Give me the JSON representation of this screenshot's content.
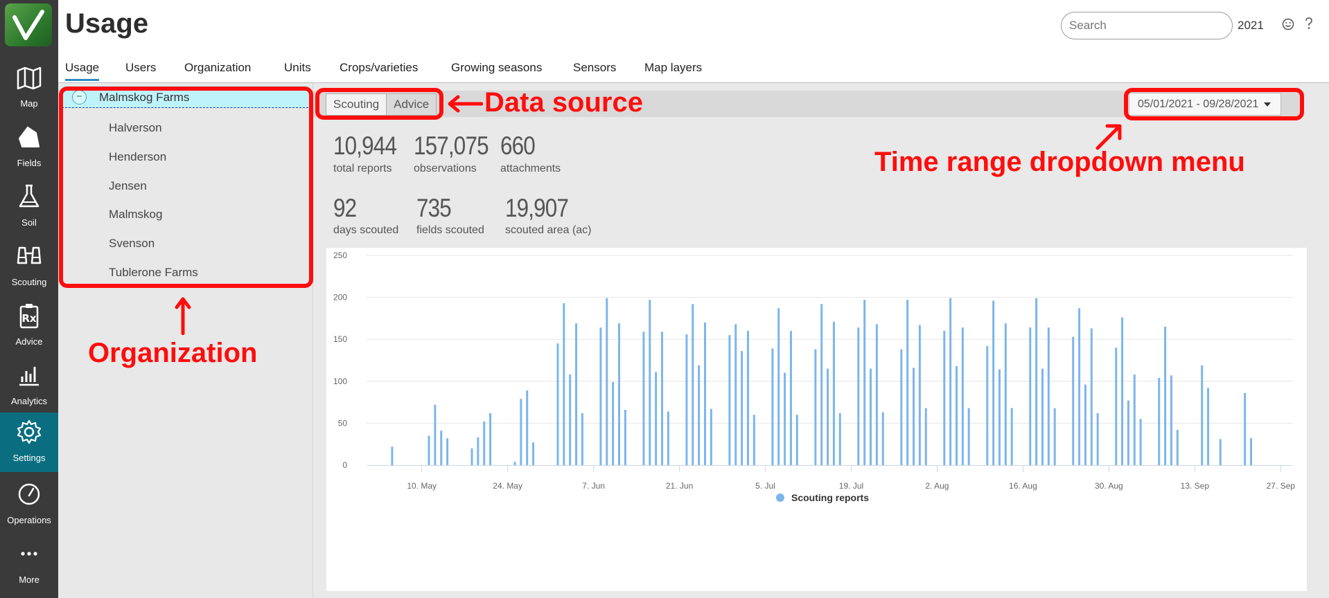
{
  "header": {
    "title": "Usage",
    "search_placeholder": "Search",
    "year": "2021"
  },
  "rail": [
    {
      "label": "Map",
      "icon": "map-icon"
    },
    {
      "label": "Fields",
      "icon": "fields-icon"
    },
    {
      "label": "Soil",
      "icon": "flask-icon"
    },
    {
      "label": "Scouting",
      "icon": "binoculars-icon"
    },
    {
      "label": "Advice",
      "icon": "prescription-icon"
    },
    {
      "label": "Analytics",
      "icon": "analytics-icon"
    },
    {
      "label": "Settings",
      "icon": "gear-icon",
      "active": true
    },
    {
      "label": "Operations",
      "icon": "gauge-icon"
    },
    {
      "label": "More",
      "icon": "more-icon"
    }
  ],
  "tabs": [
    {
      "label": "Usage",
      "active": true
    },
    {
      "label": "Users"
    },
    {
      "label": "Organization"
    },
    {
      "label": "Units"
    },
    {
      "label": "Crops/varieties"
    },
    {
      "label": "Growing seasons"
    },
    {
      "label": "Sensors"
    },
    {
      "label": "Map layers"
    }
  ],
  "org": {
    "root": "Malmskog Farms",
    "toggle": "−",
    "children": [
      "Halverson",
      "Henderson",
      "Jensen",
      "Malmskog",
      "Svenson",
      "Tublerone Farms"
    ]
  },
  "source": {
    "options": [
      "Scouting",
      "Advice"
    ],
    "selected": "Advice"
  },
  "range": {
    "label": "05/01/2021 - 09/28/2021"
  },
  "stats": [
    {
      "value": "10,944",
      "label": "total reports"
    },
    {
      "value": "157,075",
      "label": "observations"
    },
    {
      "value": "660",
      "label": "attachments"
    },
    {
      "value": "92",
      "label": "days scouted"
    },
    {
      "value": "735",
      "label": "fields scouted"
    },
    {
      "value": "19,907",
      "label": "scouted area (ac)"
    }
  ],
  "annotations": {
    "data_source": "Data source",
    "time_range": "Time range dropdown menu",
    "organization": "Organization"
  },
  "colors": {
    "bar": "#7cb5ec",
    "accent": "#2b8bc6",
    "annotation": "#ff0d0d",
    "rail": "#3a3a3a",
    "rail_active": "#0a6e80"
  },
  "chart_data": {
    "type": "bar",
    "title": "",
    "xlabel": "",
    "ylabel": "",
    "ylim": [
      0,
      250
    ],
    "yticks": [
      0,
      50,
      100,
      150,
      200,
      250
    ],
    "x_ticks": [
      {
        "label": "10. May",
        "date": "2021-05-10"
      },
      {
        "label": "24. May",
        "date": "2021-05-24"
      },
      {
        "label": "7. Jun",
        "date": "2021-06-07"
      },
      {
        "label": "21. Jun",
        "date": "2021-06-21"
      },
      {
        "label": "5. Jul",
        "date": "2021-07-05"
      },
      {
        "label": "19. Jul",
        "date": "2021-07-19"
      },
      {
        "label": "2. Aug",
        "date": "2021-08-02"
      },
      {
        "label": "16. Aug",
        "date": "2021-08-16"
      },
      {
        "label": "30. Aug",
        "date": "2021-08-30"
      },
      {
        "label": "13. Sep",
        "date": "2021-09-13"
      },
      {
        "label": "27. Sep",
        "date": "2021-09-27"
      }
    ],
    "x_range": [
      "2021-05-01",
      "2021-09-28"
    ],
    "grid": true,
    "legend_position": "bottom",
    "series": [
      {
        "name": "Scouting reports",
        "points": [
          [
            "2021-05-05",
            22
          ],
          [
            "2021-05-11",
            35
          ],
          [
            "2021-05-12",
            72
          ],
          [
            "2021-05-13",
            41
          ],
          [
            "2021-05-14",
            32
          ],
          [
            "2021-05-18",
            20
          ],
          [
            "2021-05-19",
            33
          ],
          [
            "2021-05-20",
            52
          ],
          [
            "2021-05-21",
            62
          ],
          [
            "2021-05-25",
            4
          ],
          [
            "2021-05-26",
            79
          ],
          [
            "2021-05-27",
            89
          ],
          [
            "2021-05-28",
            27
          ],
          [
            "2021-06-01",
            145
          ],
          [
            "2021-06-02",
            193
          ],
          [
            "2021-06-03",
            108
          ],
          [
            "2021-06-04",
            169
          ],
          [
            "2021-06-05",
            62
          ],
          [
            "2021-06-08",
            164
          ],
          [
            "2021-06-09",
            199
          ],
          [
            "2021-06-10",
            99
          ],
          [
            "2021-06-11",
            169
          ],
          [
            "2021-06-12",
            66
          ],
          [
            "2021-06-15",
            159
          ],
          [
            "2021-06-16",
            197
          ],
          [
            "2021-06-17",
            111
          ],
          [
            "2021-06-18",
            159
          ],
          [
            "2021-06-19",
            64
          ],
          [
            "2021-06-22",
            156
          ],
          [
            "2021-06-23",
            192
          ],
          [
            "2021-06-24",
            119
          ],
          [
            "2021-06-25",
            170
          ],
          [
            "2021-06-26",
            67
          ],
          [
            "2021-06-29",
            155
          ],
          [
            "2021-06-30",
            168
          ],
          [
            "2021-07-01",
            136
          ],
          [
            "2021-07-02",
            160
          ],
          [
            "2021-07-03",
            60
          ],
          [
            "2021-07-06",
            139
          ],
          [
            "2021-07-07",
            187
          ],
          [
            "2021-07-08",
            110
          ],
          [
            "2021-07-09",
            160
          ],
          [
            "2021-07-10",
            60
          ],
          [
            "2021-07-13",
            138
          ],
          [
            "2021-07-14",
            192
          ],
          [
            "2021-07-15",
            115
          ],
          [
            "2021-07-16",
            171
          ],
          [
            "2021-07-17",
            62
          ],
          [
            "2021-07-20",
            164
          ],
          [
            "2021-07-21",
            197
          ],
          [
            "2021-07-22",
            115
          ],
          [
            "2021-07-23",
            168
          ],
          [
            "2021-07-24",
            63
          ],
          [
            "2021-07-27",
            138
          ],
          [
            "2021-07-28",
            197
          ],
          [
            "2021-07-29",
            116
          ],
          [
            "2021-07-30",
            167
          ],
          [
            "2021-07-31",
            68
          ],
          [
            "2021-08-03",
            160
          ],
          [
            "2021-08-04",
            199
          ],
          [
            "2021-08-05",
            118
          ],
          [
            "2021-08-06",
            164
          ],
          [
            "2021-08-07",
            68
          ],
          [
            "2021-08-10",
            142
          ],
          [
            "2021-08-11",
            196
          ],
          [
            "2021-08-12",
            114
          ],
          [
            "2021-08-13",
            169
          ],
          [
            "2021-08-14",
            68
          ],
          [
            "2021-08-17",
            164
          ],
          [
            "2021-08-18",
            199
          ],
          [
            "2021-08-19",
            115
          ],
          [
            "2021-08-20",
            164
          ],
          [
            "2021-08-21",
            68
          ],
          [
            "2021-08-24",
            153
          ],
          [
            "2021-08-25",
            187
          ],
          [
            "2021-08-26",
            96
          ],
          [
            "2021-08-27",
            163
          ],
          [
            "2021-08-28",
            62
          ],
          [
            "2021-08-31",
            140
          ],
          [
            "2021-09-01",
            176
          ],
          [
            "2021-09-02",
            77
          ],
          [
            "2021-09-03",
            108
          ],
          [
            "2021-09-04",
            55
          ],
          [
            "2021-09-07",
            104
          ],
          [
            "2021-09-08",
            165
          ],
          [
            "2021-09-09",
            107
          ],
          [
            "2021-09-10",
            42
          ],
          [
            "2021-09-14",
            119
          ],
          [
            "2021-09-15",
            92
          ],
          [
            "2021-09-17",
            31
          ],
          [
            "2021-09-21",
            86
          ],
          [
            "2021-09-22",
            32
          ]
        ]
      }
    ]
  }
}
